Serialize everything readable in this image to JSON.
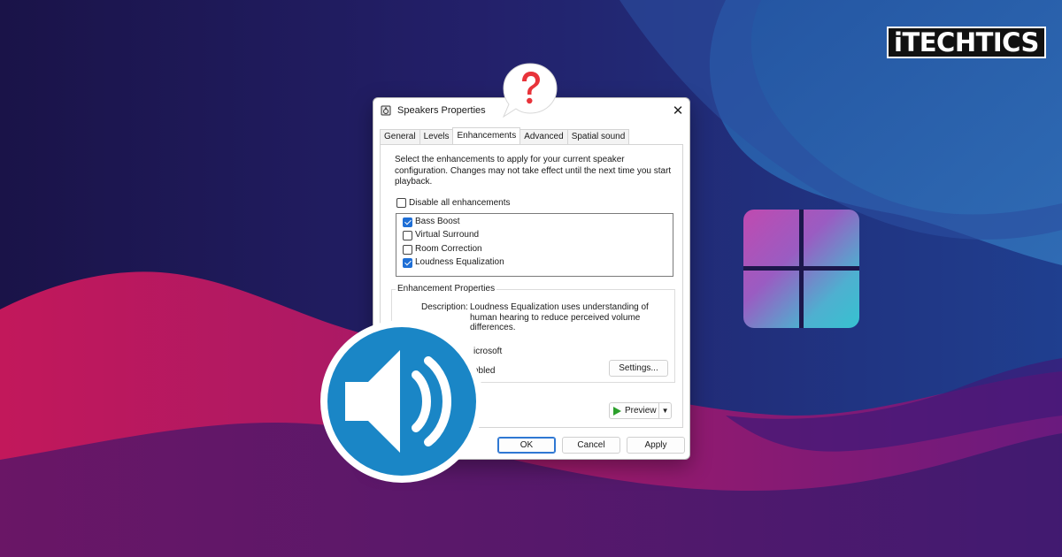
{
  "brand": {
    "logo_text": "iTECHTICS"
  },
  "colors": {
    "background": "#1a1450",
    "accent_blue": "#1f6fd6",
    "speaker_blue": "#1a86c6",
    "question_red": "#e8333a",
    "play_green": "#2ca02c"
  },
  "icons": {
    "windows_logo": "windows-11-logo",
    "speaker": "speaker-volume-icon",
    "question": "question-mark-bubble"
  },
  "dialog": {
    "title": "Speakers Properties",
    "close_glyph": "✕",
    "tabs": [
      {
        "label": "General",
        "active": false
      },
      {
        "label": "Levels",
        "active": false
      },
      {
        "label": "Enhancements",
        "active": true
      },
      {
        "label": "Advanced",
        "active": false
      },
      {
        "label": "Spatial sound",
        "active": false
      }
    ],
    "description": "Select the enhancements to apply for your current speaker configuration. Changes may not take effect until the next time you start playback.",
    "disable_all": {
      "label": "Disable all enhancements",
      "checked": false
    },
    "enhancements": [
      {
        "label": "Bass Boost",
        "checked": true
      },
      {
        "label": "Virtual Surround",
        "checked": false
      },
      {
        "label": "Room Correction",
        "checked": false
      },
      {
        "label": "Loudness Equalization",
        "checked": true
      }
    ],
    "properties": {
      "group_title": "Enhancement Properties",
      "description_label": "Description:",
      "description_text": "Loudness Equalization uses understanding of human hearing to reduce perceived volume differences.",
      "provider_partial": "icrosoft",
      "status_partial": "nbled",
      "settings_button": "Settings..."
    },
    "preview_button": "Preview",
    "preview_arrow": "▼",
    "buttons": {
      "ok": "OK",
      "cancel": "Cancel",
      "apply": "Apply"
    }
  }
}
